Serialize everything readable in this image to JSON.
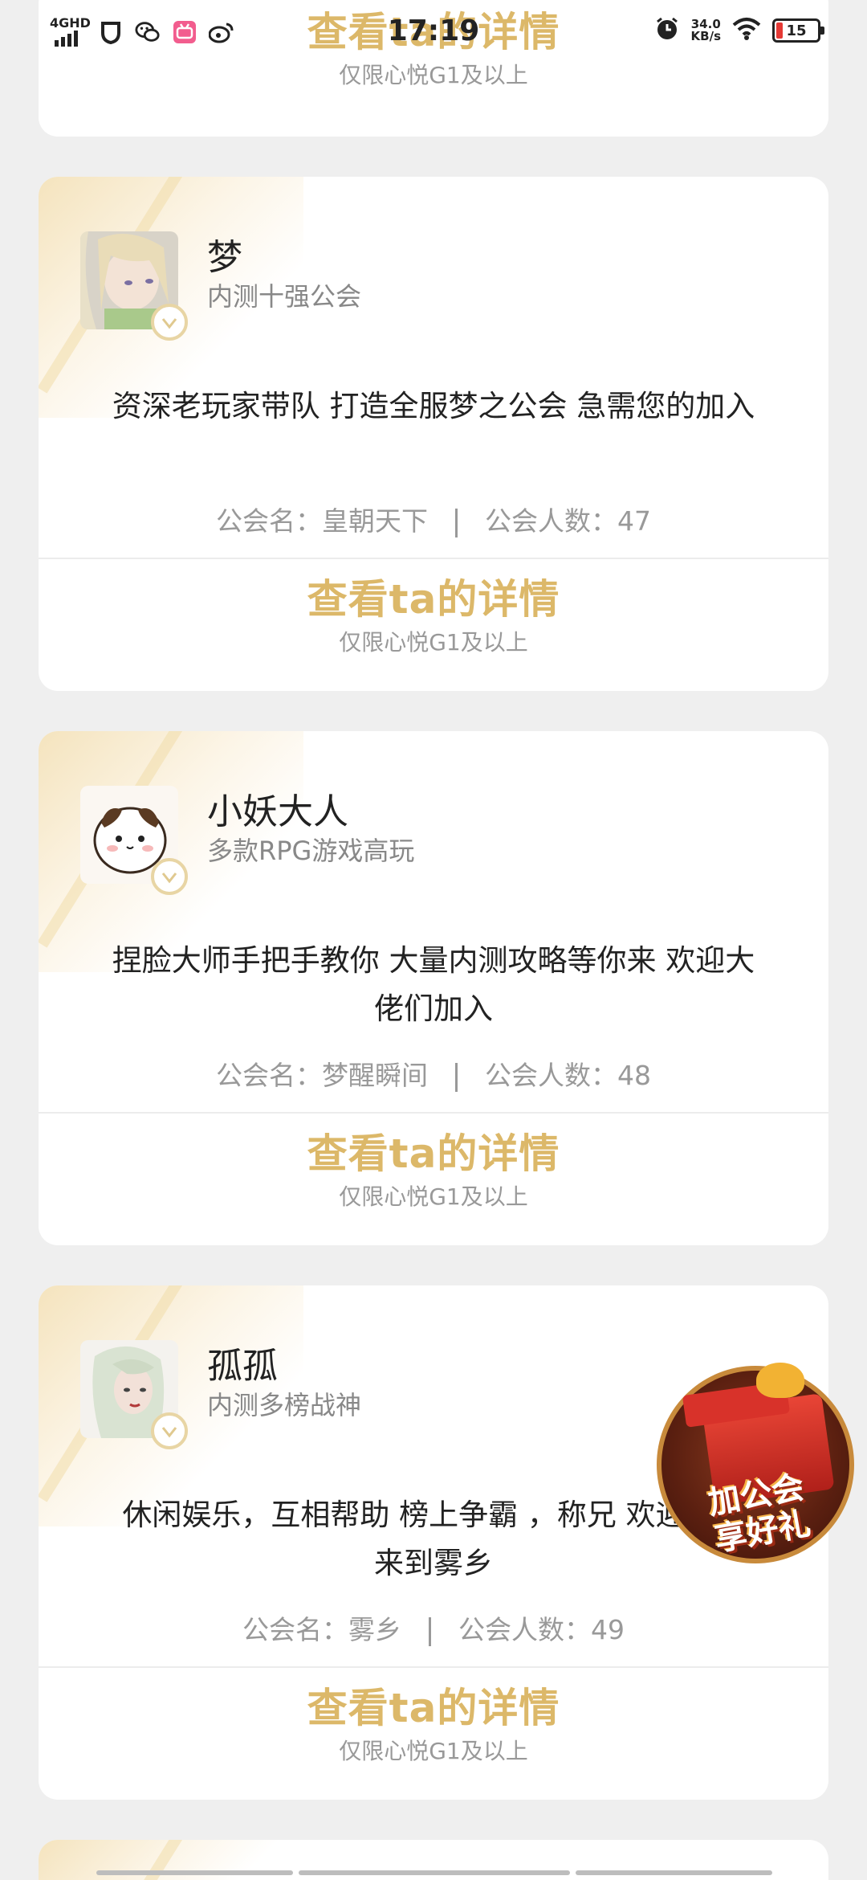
{
  "status_bar": {
    "network": "4GHD",
    "time": "17:19",
    "speed_value": "34.0",
    "speed_unit": "KB/s",
    "battery": "15",
    "icons": [
      "shield-app-icon",
      "wechat-icon",
      "bilibili-app-icon",
      "weibo-icon",
      "alarm-icon",
      "wifi-icon",
      "battery-icon"
    ]
  },
  "top_card": {
    "detail_title": "查看ta的详情",
    "detail_note": "仅限心悦G1及以上"
  },
  "cards": [
    {
      "name": "梦",
      "subtitle": "内测十强公会",
      "description": "资深老玩家带队 打造全服梦之公会 急需您的加入",
      "guild_label": "公会名：皇朝天下",
      "members_label": "公会人数：47",
      "detail_title": "查看ta的详情",
      "detail_note": "仅限心悦G1及以上"
    },
    {
      "name": "小妖大人",
      "subtitle": "多款RPG游戏高玩",
      "description": "捏脸大师手把手教你 大量内测攻略等你来 欢迎大佬们加入",
      "guild_label": "公会名：梦醒瞬间",
      "members_label": "公会人数：48",
      "detail_title": "查看ta的详情",
      "detail_note": "仅限心悦G1及以上"
    },
    {
      "name": "孤孤",
      "subtitle": "内测多榜战神",
      "description": "休闲娱乐，互相帮助 榜上争霸 ，称兄 欢迎大家来到雾乡",
      "guild_label": "公会名：雾乡",
      "members_label": "公会人数：49",
      "detail_title": "查看ta的详情",
      "detail_note": "仅限心悦G1及以上"
    }
  ],
  "promo": {
    "text_line1": "加公会",
    "text_line2": "享好礼"
  },
  "colors": {
    "accent_gold": "#dcb869",
    "badge_border": "#e8d5a4",
    "background": "#efefef"
  }
}
